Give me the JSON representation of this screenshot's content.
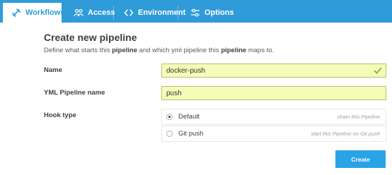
{
  "tabs": [
    {
      "label": "Workflows",
      "icon": "workflows-icon",
      "active": true
    },
    {
      "label": "Access",
      "icon": "access-icon",
      "active": false
    },
    {
      "label": "Environment",
      "icon": "code-icon",
      "active": false
    },
    {
      "label": "Options",
      "icon": "sliders-icon",
      "active": false
    }
  ],
  "form": {
    "title": "Create new pipeline",
    "description": {
      "part1": "Define what starts this ",
      "bold1": "pipeline",
      "part2": " and which yml pipeline this ",
      "bold2": "pipeline",
      "part3": " maps to."
    },
    "name_label": "Name",
    "name_value": "docker-push",
    "yml_label": "YML Pipeline name",
    "yml_value": "push",
    "hook_label": "Hook type",
    "hook_options": [
      {
        "label": "Default",
        "hint": "chain this Pipeline",
        "selected": true
      },
      {
        "label": "Git push",
        "hint": "start this Pipeline on Git push",
        "selected": false
      }
    ],
    "create_label": "Create"
  },
  "colors": {
    "accent": "#2f9bd9",
    "input_bg": "#f5fbb8",
    "check": "#6fb32f",
    "button": "#2aa3e6"
  }
}
